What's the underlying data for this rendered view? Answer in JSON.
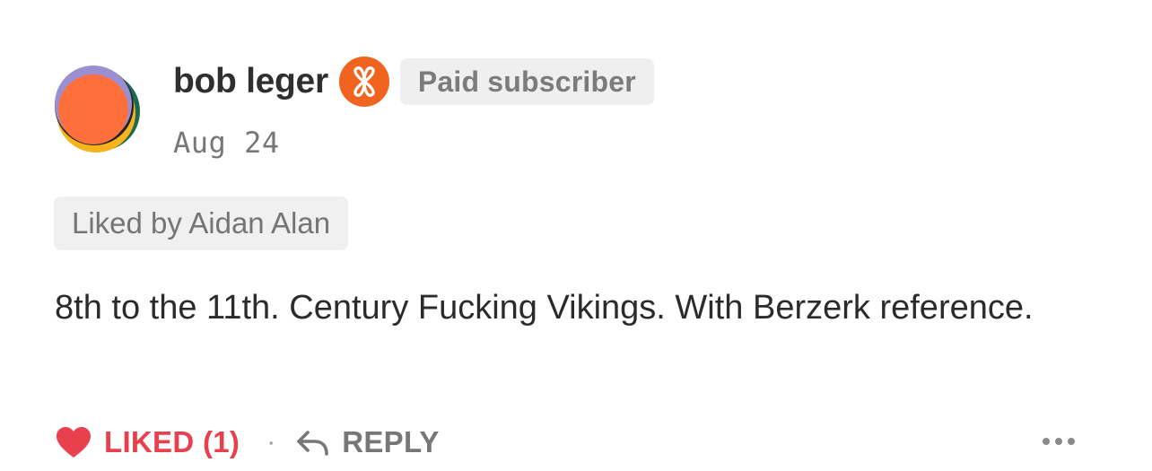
{
  "comment": {
    "author": {
      "name": "bob leger",
      "avatar_icon": "avatar-image",
      "subscriber_icon": "substack-flower-badge-icon",
      "badge_label": "Paid subscriber",
      "accent_color": "#f0641f"
    },
    "date": "Aug 24",
    "liked_by": "Liked by Aidan Alan",
    "body": "8th to the 11th. Century Fucking Vikings. With Berzerk reference."
  },
  "actions": {
    "like_icon": "heart-icon",
    "like_label": "LIKED (1)",
    "like_color": "#e8414d",
    "separator": "·",
    "reply_icon": "reply-arrow-icon",
    "reply_label": "REPLY",
    "more_icon": "more-options-icon"
  }
}
